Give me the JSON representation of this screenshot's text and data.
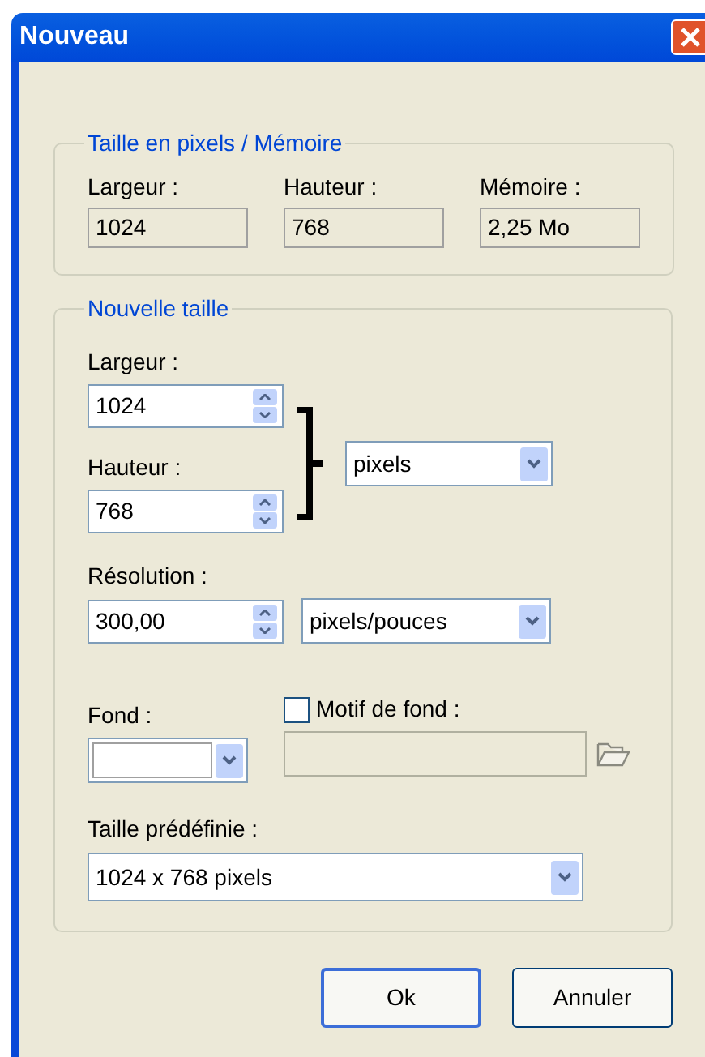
{
  "window": {
    "title": "Nouveau"
  },
  "pixel_memory": {
    "legend": "Taille en pixels / Mémoire",
    "fields": [
      {
        "label": "Largeur :",
        "value": "1024"
      },
      {
        "label": "Hauteur :",
        "value": "768"
      },
      {
        "label": "Mémoire :",
        "value": "2,25 Mo"
      }
    ]
  },
  "new_size": {
    "legend": "Nouvelle taille",
    "width": {
      "label": "Largeur :",
      "value": "1024"
    },
    "height": {
      "label": "Hauteur :",
      "value": "768"
    },
    "unit": {
      "value": "pixels"
    },
    "resolution": {
      "label": "Résolution :",
      "value": "300,00"
    },
    "resolution_unit": {
      "value": "pixels/pouces"
    },
    "background": {
      "label": "Fond :",
      "color": "#ffffff"
    },
    "pattern": {
      "label": "Motif de fond :",
      "checked": false,
      "disabled": true
    },
    "preset": {
      "label": "Taille prédéfinie :",
      "value": "1024 x 768 pixels"
    }
  },
  "buttons": [
    {
      "label": "Ok",
      "default": true
    },
    {
      "label": "Annuler",
      "default": false
    }
  ]
}
